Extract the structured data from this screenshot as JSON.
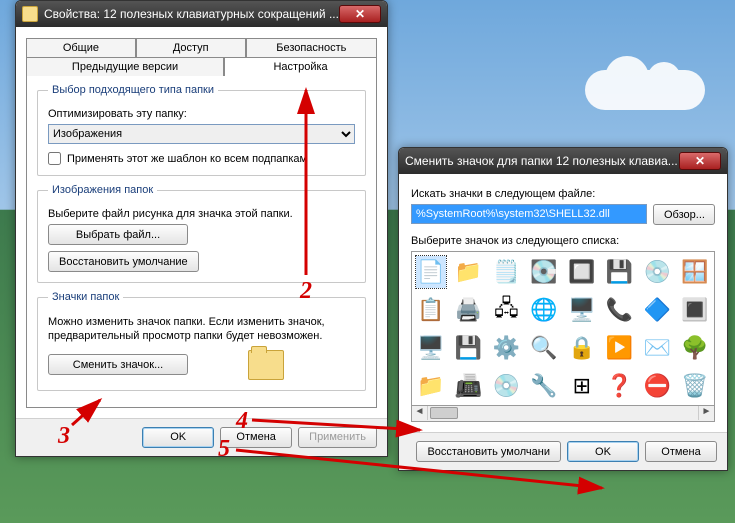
{
  "window1": {
    "title": "Свойства: 12 полезных клавиатурных сокращений ...",
    "tabs_row1": [
      "Общие",
      "Доступ",
      "Безопасность"
    ],
    "tabs_row2": [
      "Предыдущие версии",
      "Настройка"
    ],
    "active_tab": "Настройка",
    "group1": {
      "legend": "Выбор подходящего типа папки",
      "label_optimize": "Оптимизировать эту папку:",
      "combo_value": "Изображения",
      "checkbox_label": "Применять этот же шаблон ко всем подпапкам",
      "checkbox_checked": false
    },
    "group2": {
      "legend": "Изображения папок",
      "desc": "Выберите файл рисунка для значка этой папки.",
      "btn_choose": "Выбрать файл...",
      "btn_restore": "Восстановить умолчание"
    },
    "group3": {
      "legend": "Значки папок",
      "desc": "Можно изменить значок папки. Если изменить значок, предварительный просмотр папки будет невозможен.",
      "btn_change": "Сменить значок..."
    },
    "buttons": {
      "ok": "OK",
      "cancel": "Отмена",
      "apply": "Применить"
    }
  },
  "window2": {
    "title": "Сменить значок для папки 12 полезных клавиа...",
    "label_path": "Искать значки в следующем файле:",
    "path_value": "%SystemRoot%\\system32\\SHELL32.dll",
    "btn_browse": "Обзор...",
    "label_list": "Выберите значок из следующего списка:",
    "icons": [
      [
        "document-icon",
        "folder-icon",
        "page-icon",
        "drive-icon",
        "chip-icon",
        "drive2-icon",
        "cd-icon",
        "window-icon"
      ],
      [
        "list-icon",
        "printer-icon",
        "network-icon",
        "globe-icon",
        "monitor-icon",
        "phone-icon",
        "app-icon",
        "tiles-icon"
      ],
      [
        "screen-icon",
        "floppy-icon",
        "gear-icon",
        "search-icon",
        "lock-icon",
        "play-icon",
        "letter-icon",
        "tree-icon"
      ],
      [
        "folder2-icon",
        "scanner-icon",
        "disc-icon",
        "tool-icon",
        "grid-icon",
        "help-icon",
        "stop-icon",
        "bin-icon"
      ]
    ],
    "btn_restore": "Восстановить умолчани",
    "btn_ok": "OK",
    "btn_cancel": "Отмена"
  },
  "annotations": {
    "n2": "2",
    "n3": "3",
    "n4": "4",
    "n5": "5"
  }
}
